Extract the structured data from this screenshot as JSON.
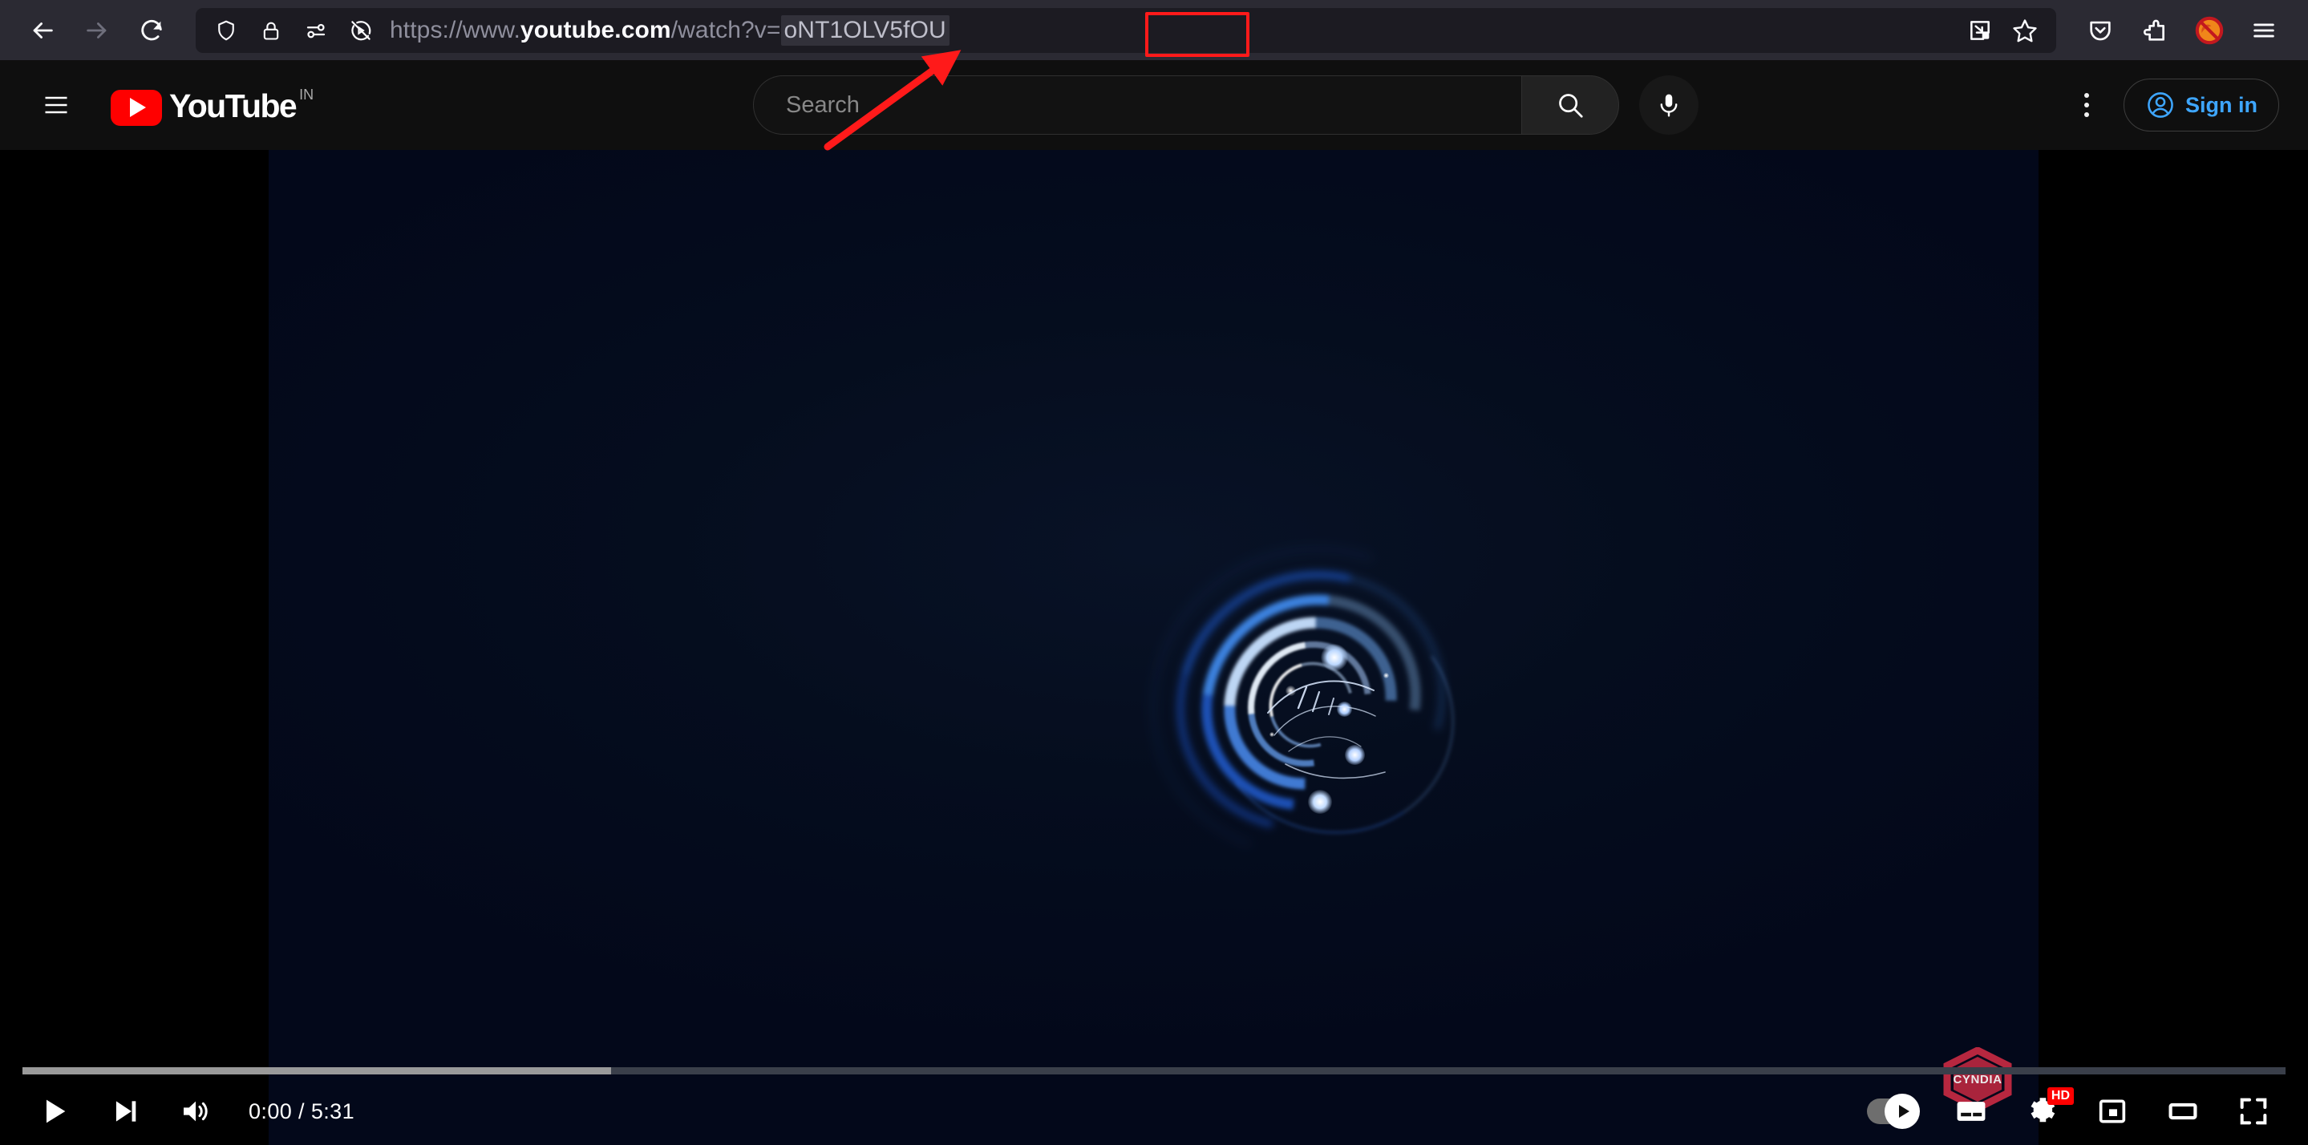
{
  "browser": {
    "back_label": "Back",
    "forward_label": "Forward",
    "reload_label": "Reload",
    "url": {
      "scheme": "https://www.",
      "domain": "youtube.com",
      "path": "/watch?v=",
      "video_id": "oNT1OLV5fOU",
      "full": "https://www.youtube.com/watch?v=oNT1OLV5fOU"
    },
    "url_icons": [
      "shield-icon",
      "lock-icon",
      "permissions-icon",
      "blocked-autoplay-icon"
    ],
    "url_right_icons": [
      "picture-in-picture-icon",
      "bookmark-star-icon"
    ],
    "toolbar_right_icons": [
      "pocket-icon",
      "extensions-icon",
      "firefox-blocker-icon",
      "app-menu-icon"
    ],
    "annotation": {
      "highlight_color": "#ff1a1a",
      "highlight_target": "oNT1OLV5fOU",
      "arrow_color": "#ff1a1a"
    }
  },
  "youtube": {
    "guide_label": "Guide",
    "logo_text": "YouTube",
    "country_code": "IN",
    "search": {
      "placeholder": "Search",
      "value": "",
      "submit_label": "Search",
      "voice_label": "Search with your voice"
    },
    "kebab_label": "Settings",
    "signin_label": "Sign in"
  },
  "player": {
    "state": "paused",
    "current_time": "0:00",
    "duration": "5:31",
    "time_display": "0:00 / 5:31",
    "progress_played_percent": 0,
    "progress_loaded_percent": 26,
    "watermark": "CYNDIA",
    "watermark_color": "#b7273f",
    "controls_left": [
      {
        "name": "play-button",
        "label": "Play"
      },
      {
        "name": "next-button",
        "label": "Next"
      },
      {
        "name": "volume-button",
        "label": "Mute"
      }
    ],
    "controls_right": [
      {
        "name": "autoplay-toggle",
        "label": "Autoplay is on",
        "state": "on"
      },
      {
        "name": "subtitles-button",
        "label": "Subtitles/closed captions"
      },
      {
        "name": "settings-button",
        "label": "Settings",
        "badge": "HD"
      },
      {
        "name": "miniplayer-button",
        "label": "Miniplayer"
      },
      {
        "name": "theater-button",
        "label": "Theater mode"
      },
      {
        "name": "fullscreen-button",
        "label": "Full screen"
      }
    ]
  },
  "colors": {
    "chrome_bg": "#2b2a33",
    "urlbar_bg": "#1c1b22",
    "yt_bg": "#0f0f0f",
    "yt_red": "#ff0000",
    "signin_blue": "#3ea6ff",
    "video_bg": "#040a18",
    "swirl_blue": "#1f6eff"
  }
}
